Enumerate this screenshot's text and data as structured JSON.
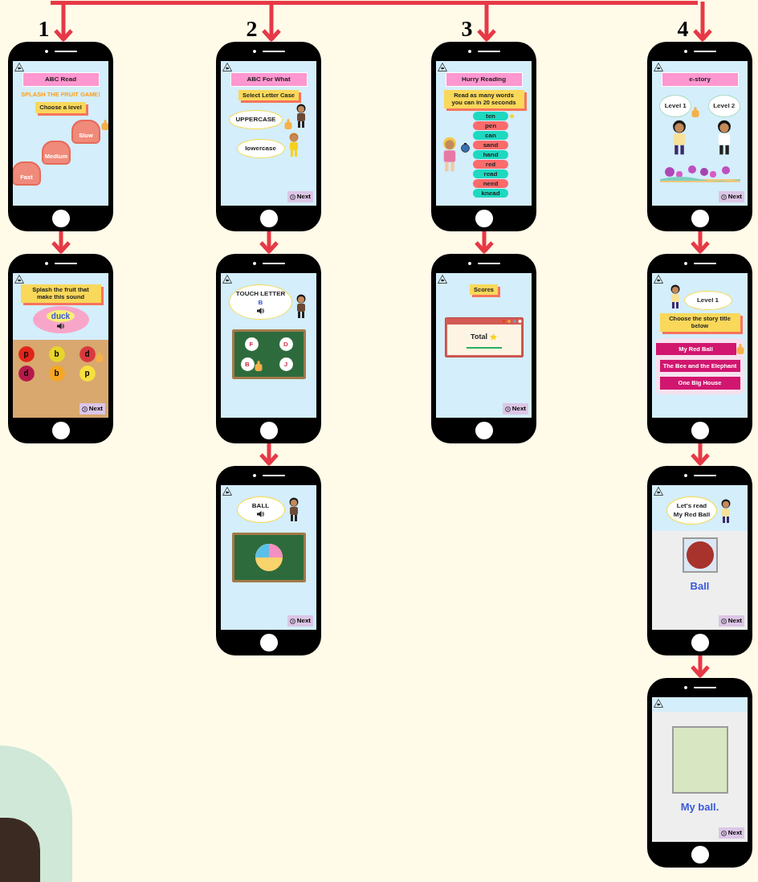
{
  "flows": [
    {
      "number": "1",
      "screens": [
        {
          "items": [
            {
              "kind": "header",
              "text": "ABC Read"
            },
            {
              "kind": "title",
              "text": "SPLASH THE FRUIT GAME!"
            },
            {
              "kind": "banner",
              "text": "Choose a level"
            },
            {
              "kind": "baskets",
              "labels": [
                {
                  "text": "Slow",
                  "pointer": true
                },
                {
                  "text": "Medium"
                },
                {
                  "text": "Fast"
                }
              ]
            }
          ]
        },
        {
          "items": [
            {
              "kind": "banner",
              "text": "Splash the fruit that make this sound"
            },
            {
              "kind": "plate",
              "text": "duck",
              "speaker": true
            },
            {
              "kind": "wood_section",
              "items": [
                {
                  "kind": "fruits",
                  "fruits": [
                    {
                      "letter": "p",
                      "color": "#e0261b"
                    },
                    {
                      "letter": "b",
                      "color": "#e8d52a"
                    },
                    {
                      "letter": "d",
                      "color": "#d9393e",
                      "pointer": true
                    },
                    {
                      "letter": "d",
                      "color": "#b5194b"
                    },
                    {
                      "letter": "b",
                      "color": "#f5a623"
                    },
                    {
                      "letter": "p",
                      "color": "#f7e03c"
                    }
                  ]
                },
                {
                  "kind": "next",
                  "text": "Next"
                }
              ]
            }
          ]
        }
      ]
    },
    {
      "number": "2",
      "screens": [
        {
          "items": [
            {
              "kind": "header",
              "text": "ABC For What"
            },
            {
              "kind": "banner",
              "text": "Select Letter Case"
            },
            {
              "kind": "bubble",
              "lines": [
                {
                  "text": "UPPERCASE"
                }
              ],
              "figure": {
                "kind": "boy"
              },
              "pointer": true
            },
            {
              "kind": "bubble",
              "lines": [
                {
                  "text": "lowercase"
                }
              ],
              "figure": {
                "kind": "girl"
              }
            },
            {
              "kind": "next",
              "text": "Next"
            }
          ]
        },
        {
          "items": [
            {
              "kind": "bubble",
              "lines": [
                {
                  "text": "TOUCH LETTER",
                  "accent": false
                },
                {
                  "text": "B",
                  "accent": true
                }
              ],
              "speaker": true,
              "figure": {
                "kind": "boy"
              }
            },
            {
              "kind": "board",
              "letters": [
                {
                  "text": "F"
                },
                {
                  "text": "D"
                },
                {
                  "text": "B",
                  "pointer": true
                },
                {
                  "text": "J"
                }
              ]
            }
          ]
        },
        {
          "items": [
            {
              "kind": "bubble",
              "lines": [
                {
                  "text": "BALL"
                }
              ],
              "speaker": true,
              "figure": {
                "kind": "boy"
              }
            },
            {
              "kind": "board_ball"
            },
            {
              "kind": "next",
              "text": "Next"
            }
          ]
        }
      ]
    },
    {
      "number": "3",
      "screens": [
        {
          "items": [
            {
              "kind": "header",
              "text": "Hurry Reading"
            },
            {
              "kind": "banner",
              "text": "Read as many words you can in 20 seconds"
            },
            {
              "kind": "word_race",
              "figure": {
                "kind": "girl-blonde"
              },
              "words": [
                {
                  "text": "ten",
                  "color": "#1fd8c0",
                  "star": true
                },
                {
                  "text": "pen",
                  "color": "#fb6b6b"
                },
                {
                  "text": "can",
                  "color": "#1fd8c0"
                },
                {
                  "text": "sand",
                  "color": "#fb6b6b"
                },
                {
                  "text": "hand",
                  "color": "#1fd8c0"
                },
                {
                  "text": "red",
                  "color": "#fb6b6b"
                },
                {
                  "text": "read",
                  "color": "#1fd8c0"
                },
                {
                  "text": "need",
                  "color": "#fb6b6b"
                },
                {
                  "text": "knead",
                  "color": "#1fd8c0"
                }
              ]
            }
          ]
        },
        {
          "items": [
            {
              "kind": "banner",
              "text": "Scores"
            },
            {
              "kind": "total",
              "text": "Total"
            },
            {
              "kind": "next",
              "text": "Next"
            }
          ]
        }
      ]
    },
    {
      "number": "4",
      "screens": [
        {
          "items": [
            {
              "kind": "header",
              "text": "e-story"
            },
            {
              "kind": "levels",
              "levels": [
                {
                  "text": "Level 1",
                  "figure": {
                    "kind": "girl-dark"
                  },
                  "pointer": true
                },
                {
                  "text": "Level 2",
                  "figure": {
                    "kind": "boy-dark"
                  }
                }
              ]
            },
            {
              "kind": "trees"
            },
            {
              "kind": "next",
              "text": "Next"
            }
          ]
        },
        {
          "items": [
            {
              "kind": "bubble",
              "lines": [
                {
                  "text": "Level 1"
                }
              ],
              "figure": {
                "kind": "girl-dark"
              },
              "figure_first": true
            },
            {
              "kind": "banner",
              "text": "Choose the story title below"
            },
            {
              "kind": "stories",
              "titles": [
                {
                  "text": "My Red Ball",
                  "pointer": true
                },
                {
                  "text": "The Bee and the Elephant"
                },
                {
                  "text": "One Big House"
                }
              ]
            }
          ]
        },
        {
          "items": [
            {
              "kind": "bubble",
              "lines": [
                {
                  "text": "Let's read"
                },
                {
                  "text": "My Red Ball"
                }
              ],
              "figure": {
                "kind": "girl-dark"
              }
            },
            {
              "kind": "marble_section",
              "items": [
                {
                  "kind": "framed_ball"
                },
                {
                  "kind": "caption",
                  "text": "Ball"
                },
                {
                  "kind": "next",
                  "text": "Next"
                }
              ]
            }
          ]
        },
        {
          "items": [
            {
              "kind": "marble_section",
              "items": [
                {
                  "kind": "illustration"
                },
                {
                  "kind": "caption",
                  "text": "My ball."
                },
                {
                  "kind": "next",
                  "text": "Next"
                }
              ]
            }
          ]
        }
      ]
    }
  ]
}
